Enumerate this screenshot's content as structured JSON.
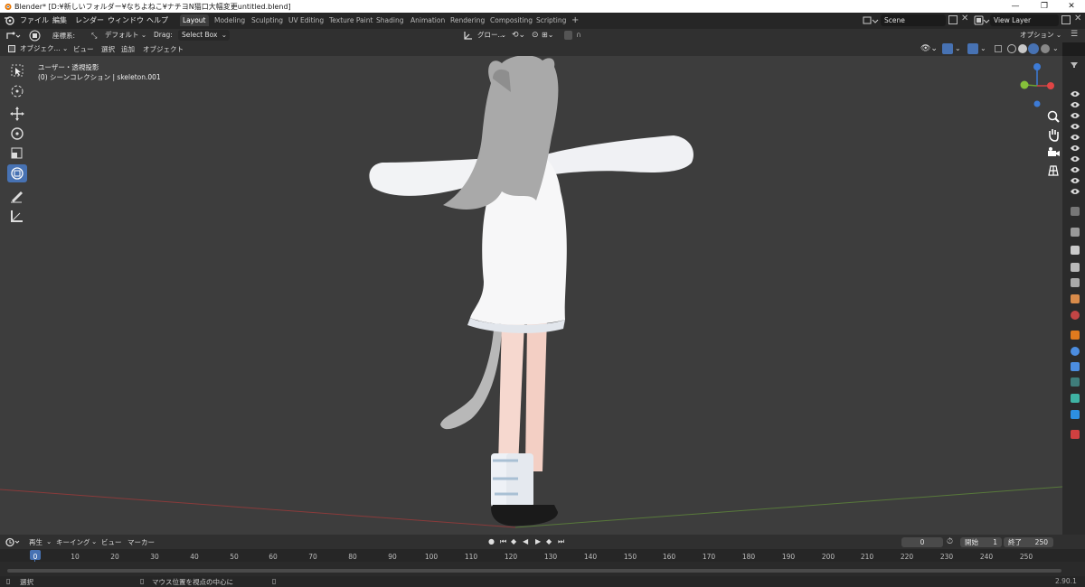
{
  "window": {
    "title": "Blender* [D:¥新しいフォルダー¥なちよねこ¥ナチヨN猫口大幅変更untitled.blend]",
    "controls": [
      "—",
      "❐",
      "✕"
    ]
  },
  "menu": [
    "ファイル",
    "編集",
    "レンダー",
    "ウィンドウ",
    "ヘルプ"
  ],
  "workspaces": [
    "Layout",
    "Modeling",
    "Sculpting",
    "UV Editing",
    "Texture Paint",
    "Shading",
    "Animation",
    "Rendering",
    "Compositing",
    "Scripting",
    "+"
  ],
  "active_workspace": "Layout",
  "scene": {
    "name": "Scene",
    "view_layer": "View Layer"
  },
  "tool_header": {
    "orientation_label": "座標系:",
    "orientation_value": "デフォルト",
    "drag_label": "Drag:",
    "drag_value": "Select Box",
    "transform_value": "グロー...",
    "options_label": "オプション"
  },
  "viewport_header": {
    "mode": "オブジェク...",
    "menus": [
      "ビュー",
      "選択",
      "追加",
      "オブジェクト"
    ]
  },
  "viewport": {
    "view_name": "ユーザー・透視投影",
    "collection": "(0) シーンコレクション | skeleton.001"
  },
  "timeline": {
    "menus": [
      "再生",
      "キーイング",
      "ビュー",
      "マーカー"
    ],
    "current_frame": "0",
    "start_label": "開始",
    "start": "1",
    "end_label": "終了",
    "end": "250",
    "ruler": [
      "0",
      "10",
      "20",
      "30",
      "40",
      "50",
      "60",
      "70",
      "80",
      "90",
      "100",
      "110",
      "120",
      "130",
      "140",
      "150",
      "160",
      "170",
      "180",
      "190",
      "200",
      "210",
      "220",
      "230",
      "240",
      "250"
    ]
  },
  "status": {
    "left": "選択",
    "middle": "マウス位置を視点の中心に",
    "version": "2.90.1"
  },
  "colors": {
    "accent": "#4772b3",
    "active_tab": "#3d3d3d",
    "viewport_bg": "#3d3d3d",
    "frame_marker": "#4772b3"
  }
}
